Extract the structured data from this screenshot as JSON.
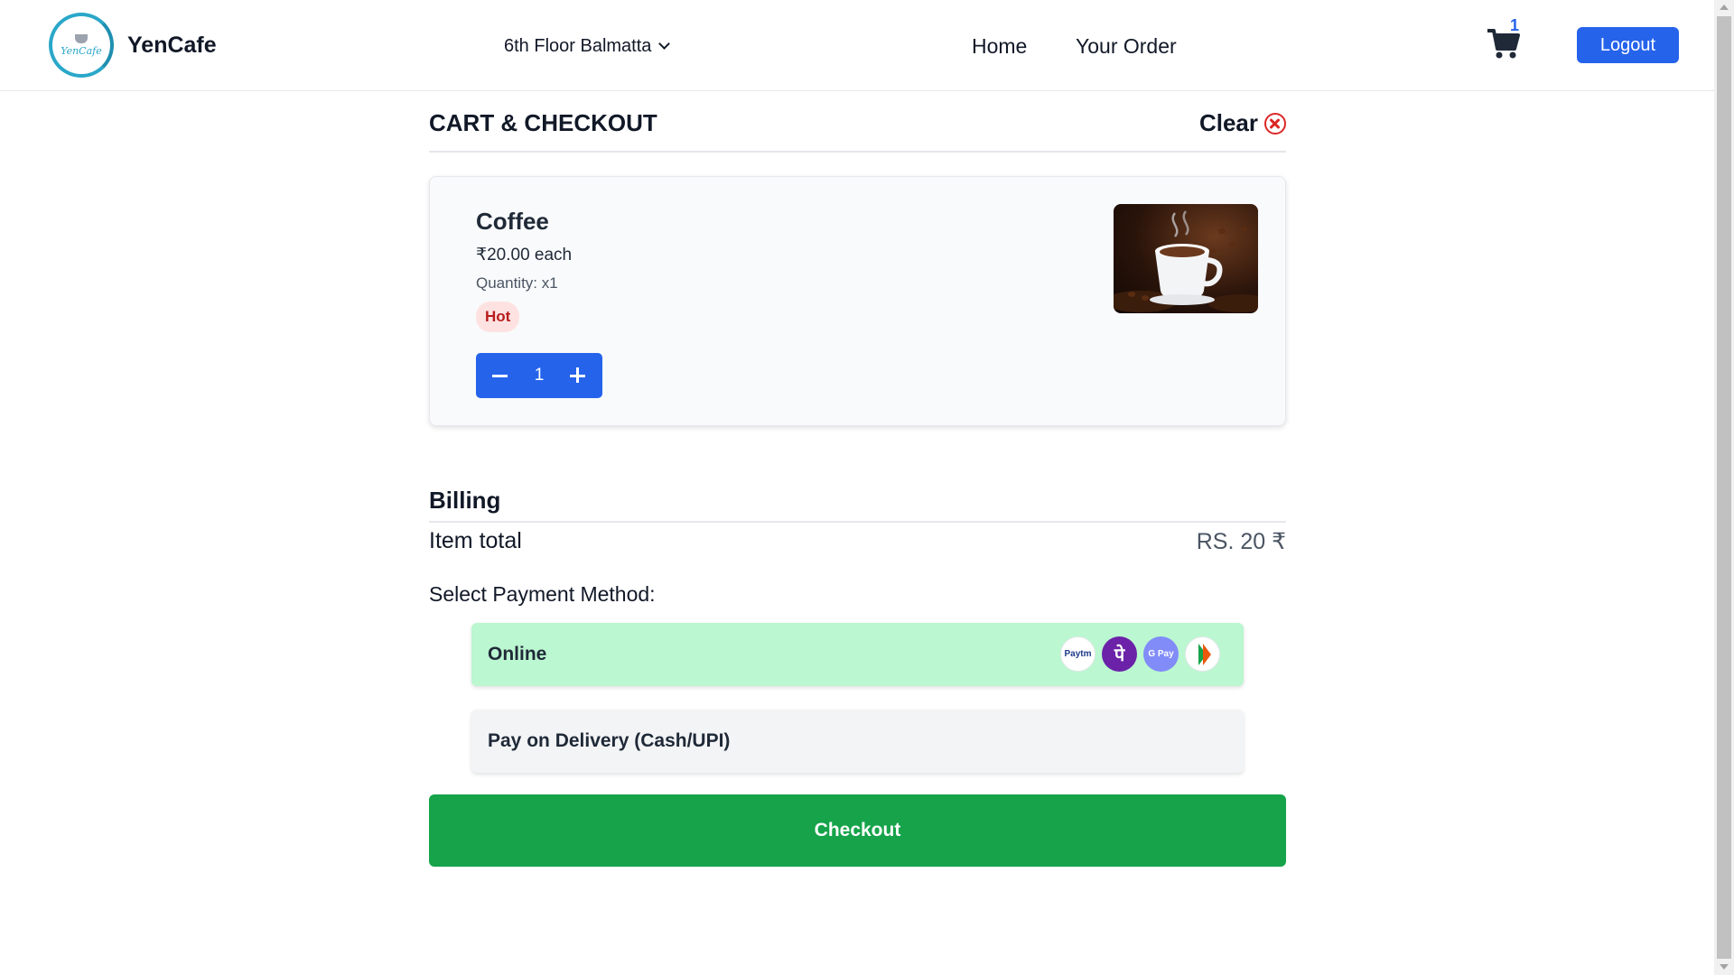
{
  "header": {
    "logo_text": "YenCafe",
    "brand": "YenCafe",
    "location": "6th Floor Balmatta",
    "nav": {
      "home": "Home",
      "your_order": "Your Order"
    },
    "cart_count": "1",
    "logout_label": "Logout"
  },
  "cart": {
    "title": "CART & CHECKOUT",
    "clear_label": "Clear",
    "items": [
      {
        "name": "Coffee",
        "price": "₹20.00 each",
        "quantity": "Quantity: x1",
        "tag": "Hot",
        "count": "1"
      }
    ]
  },
  "billing": {
    "title": "Billing",
    "item_total_label": "Item total",
    "item_total_value": "RS. 20 ₹"
  },
  "payment": {
    "title": "Select Payment Method:",
    "options": [
      {
        "label": "Online",
        "selected": true,
        "icons": [
          "paytm-icon",
          "phonepe-icon",
          "gpay-icon",
          "bhim-icon"
        ]
      },
      {
        "label": "Pay on Delivery (Cash/UPI)",
        "selected": false
      }
    ],
    "icon_text": {
      "paytm": "Paytm",
      "phonepe": "पे",
      "gpay": "G Pay"
    }
  },
  "checkout_label": "Checkout",
  "colors": {
    "primary": "#2563eb",
    "success": "#16a34a",
    "online_bg": "#bbf7d0",
    "danger": "#dc2626"
  }
}
